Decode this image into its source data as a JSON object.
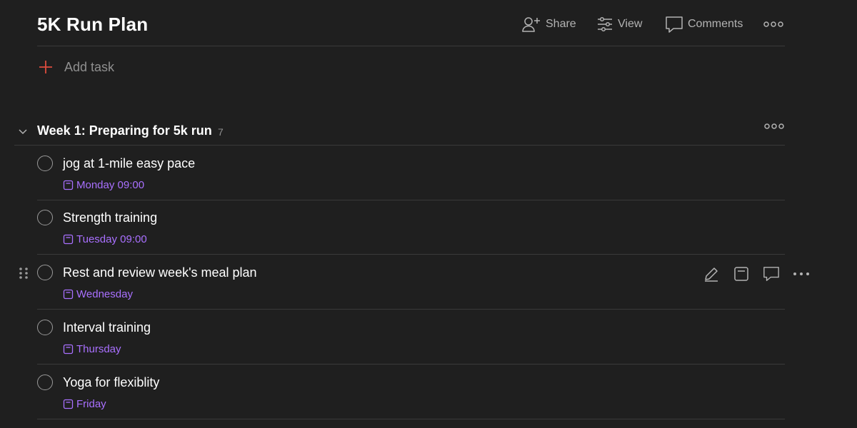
{
  "page": {
    "title": "5K Run Plan"
  },
  "header": {
    "share_label": "Share",
    "view_label": "View",
    "comments_label": "Comments",
    "more_icon": "more-horizontal-icon"
  },
  "add_task": {
    "label": "Add task",
    "icon": "plus-icon"
  },
  "section": {
    "title": "Week 1: Preparing for 5k run",
    "count": "7",
    "collapse_icon": "chevron-down-icon"
  },
  "tasks": [
    {
      "name": "jog at 1-mile easy pace",
      "due": "Monday 09:00"
    },
    {
      "name": "Strength training",
      "due": "Tuesday 09:00"
    },
    {
      "name": "Rest and review week's meal plan",
      "due": "Wednesday"
    },
    {
      "name": "Interval training",
      "due": "Thursday"
    },
    {
      "name": "Yoga for flexiblity",
      "due": "Friday"
    }
  ],
  "hover_actions": [
    "edit-icon",
    "due-date-icon",
    "comment-icon",
    "more-horizontal-icon"
  ],
  "colors": {
    "background": "#1f1f1f",
    "due_date": "#a970ff",
    "add_plus": "#dc4c3e",
    "muted": "#8f8f8f"
  }
}
